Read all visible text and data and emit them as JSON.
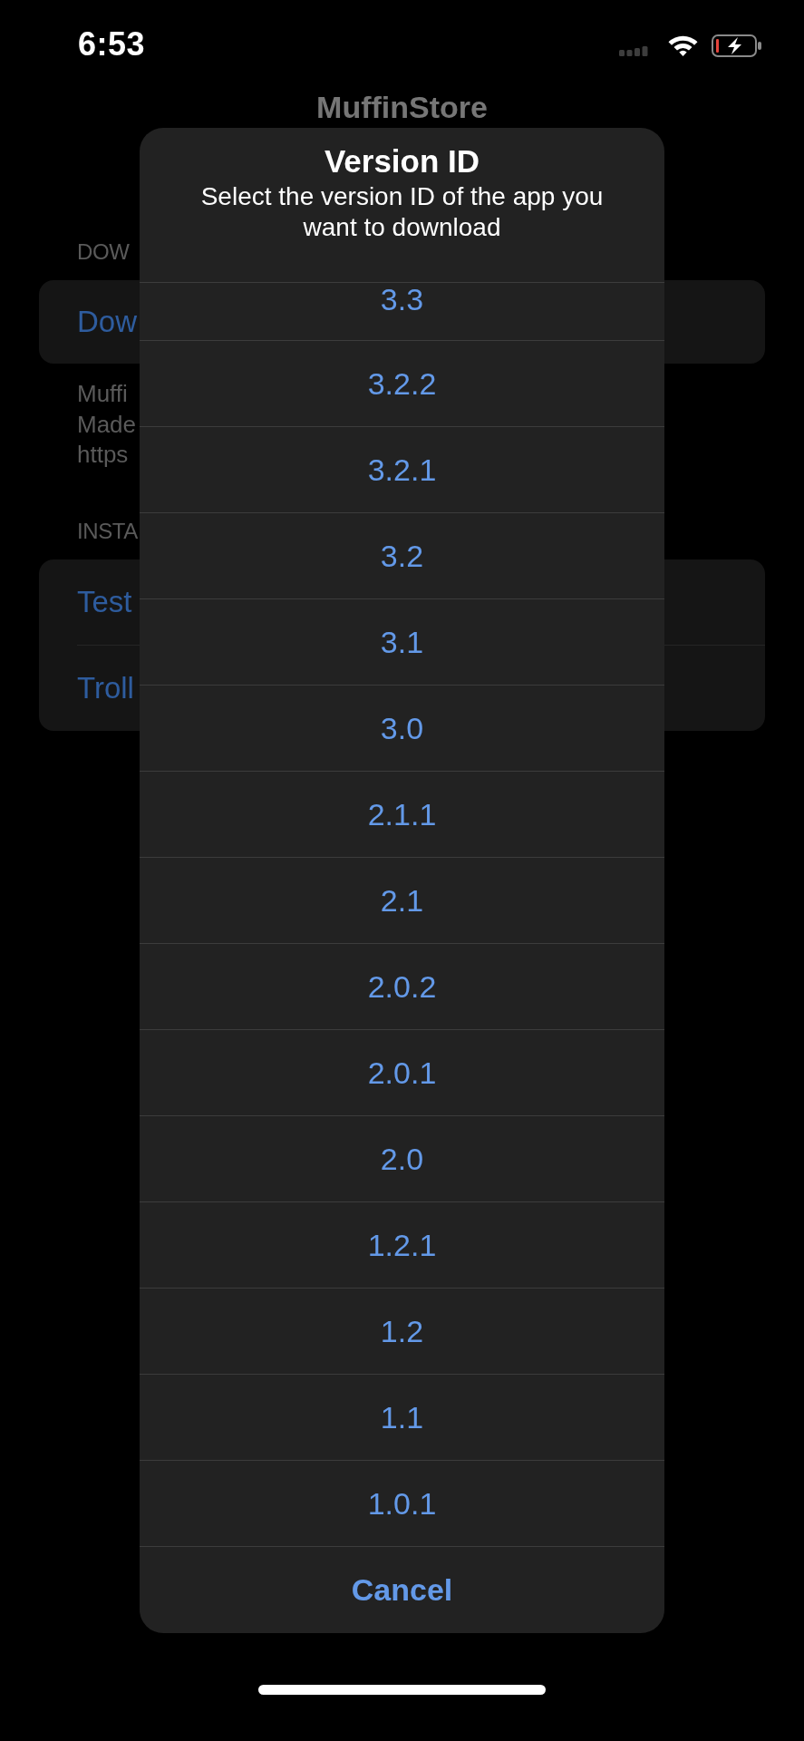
{
  "status_bar": {
    "time": "6:53"
  },
  "app": {
    "title": "MuffinStore",
    "sections": [
      {
        "header": "DOW",
        "rows": [
          "Dow"
        ],
        "footer_lines": [
          "Muffi",
          "Made",
          "https"
        ]
      },
      {
        "header": "INSTA",
        "rows": [
          "Test",
          "Troll"
        ]
      }
    ]
  },
  "alert": {
    "title": "Version ID",
    "message": "Select the version ID of the app you want to download",
    "options": [
      "3.3",
      "3.2.2",
      "3.2.1",
      "3.2",
      "3.1",
      "3.0",
      "2.1.1",
      "2.1",
      "2.0.2",
      "2.0.1",
      "2.0",
      "1.2.1",
      "1.2",
      "1.1",
      "1.0.1"
    ],
    "cancel": "Cancel"
  }
}
